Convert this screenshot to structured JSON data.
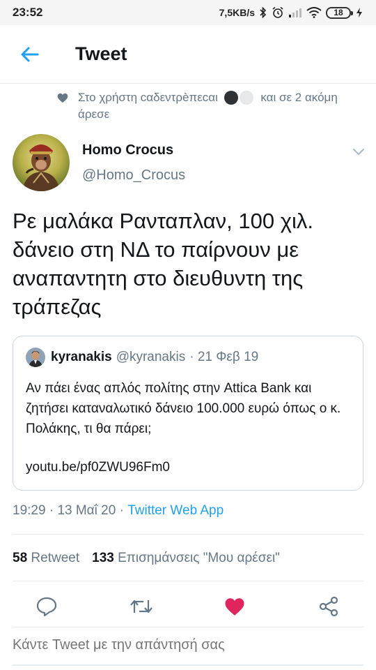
{
  "status_bar": {
    "time": "23:52",
    "speed": "7,5KB/s",
    "battery": "18"
  },
  "header": {
    "title": "Tweet"
  },
  "social_context": {
    "text_before": "Στο χρήστη cαδεντρèπεcαι",
    "text_after": "και σε 2 ακόμη άρεσε"
  },
  "author": {
    "name": "Homo Crocus",
    "handle": "@Homo_Crocus"
  },
  "tweet": {
    "text": "Ρε μαλάκα Ρανταπλαν, 100 χιλ. δάνειο στη ΝΔ το παίρνουν με αναπαντητη στο διευθυντη της τράπεζας"
  },
  "quote": {
    "name": "kyranakis",
    "handle": "@kyranakis",
    "date": "· 21 Φεβ 19",
    "text": "Αν πάει ένας απλός πολίτης στην Attica Bank και ζητήσει καταναλωτικό δάνειο 100.000 ευρώ όπως ο κ. Πολάκης, τι θα πάρει;",
    "link": "youtu.be/pf0ZWU96Fm0"
  },
  "meta": {
    "time_date": "19:29 · 13 Μαΐ 20 ·",
    "app": "Twitter Web App"
  },
  "stats": {
    "retweets_count": "58",
    "retweets_label": "Retweet",
    "likes_count": "133",
    "likes_label": "Επισημάνσεις \"Μου αρέσει\""
  },
  "reply": {
    "placeholder": "Κάντε Tweet με την απάντησή σας"
  },
  "colors": {
    "accent": "#1da1f2",
    "like": "#e0245e",
    "secondary_text": "#657786"
  },
  "icons": [
    "back-arrow-icon",
    "heart-icon",
    "chevron-down-icon",
    "reply-icon",
    "retweet-icon",
    "like-heart-icon",
    "share-icon"
  ]
}
